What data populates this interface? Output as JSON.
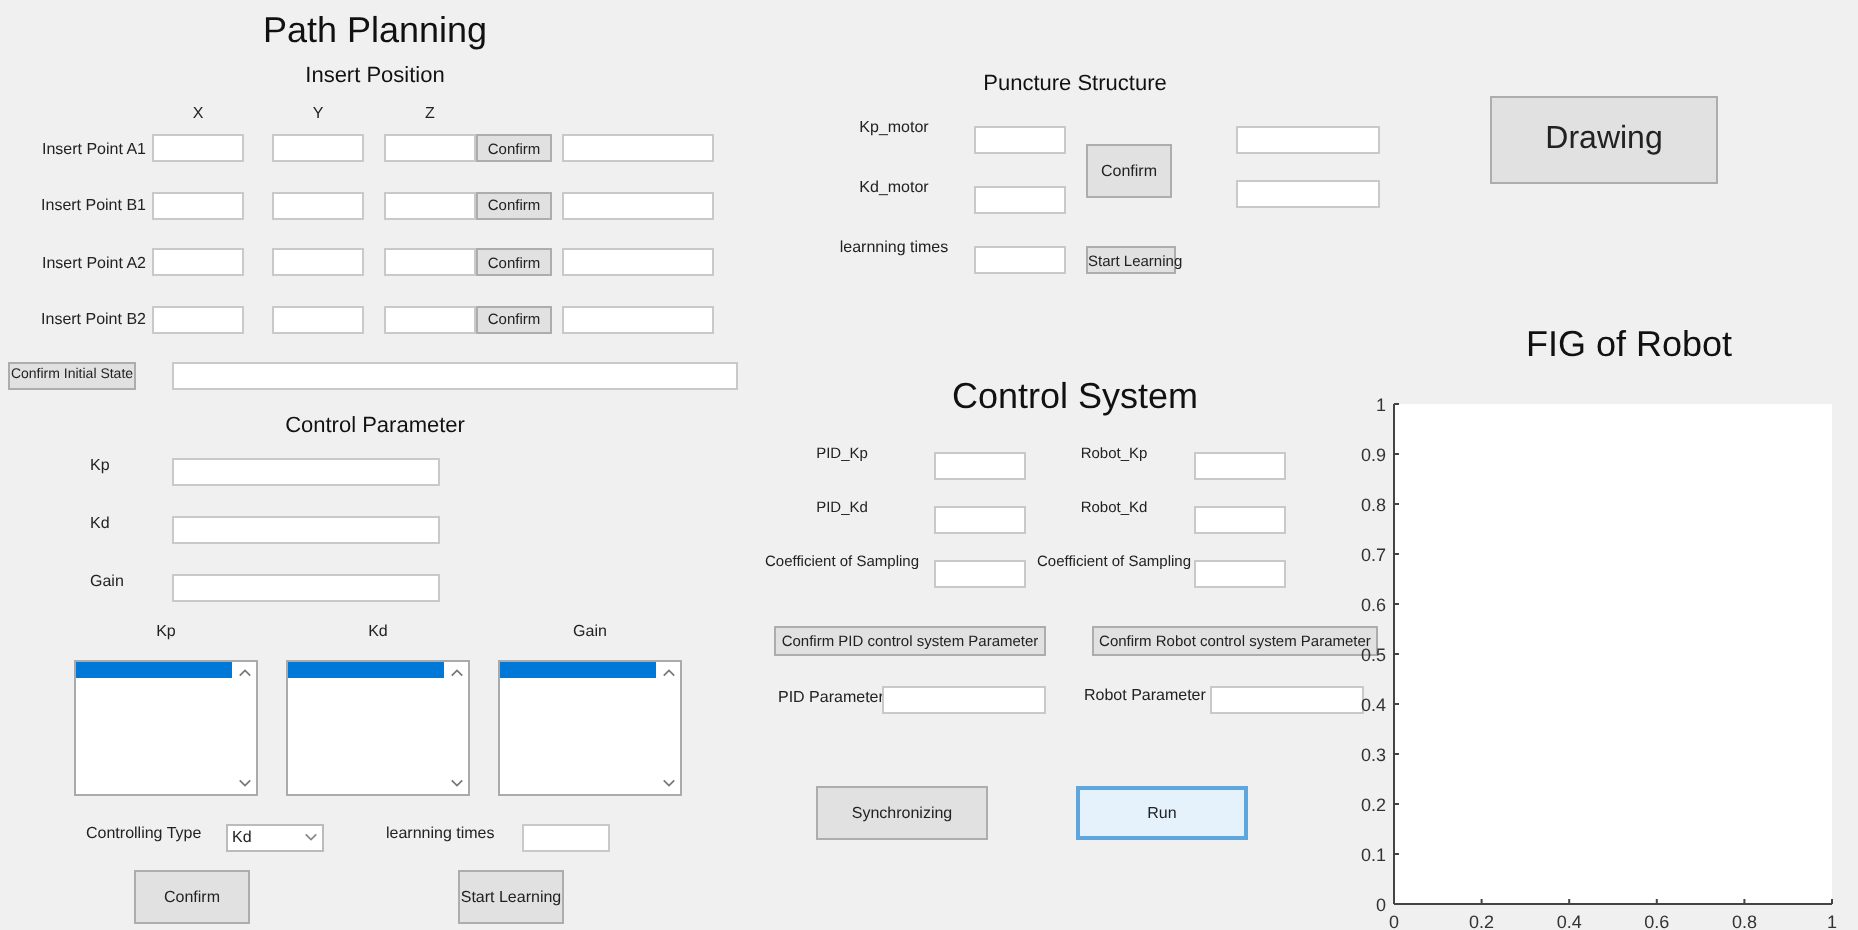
{
  "path_planning": {
    "title": "Path Planning",
    "insert_position": {
      "title": "Insert Position",
      "axes": [
        "X",
        "Y",
        "Z"
      ],
      "rows": [
        {
          "label": "Insert Point A1",
          "button": "Confirm"
        },
        {
          "label": "Insert Point B1",
          "button": "Confirm"
        },
        {
          "label": "Insert Point A2",
          "button": "Confirm"
        },
        {
          "label": "Insert Point B2",
          "button": "Confirm"
        }
      ],
      "initial_state_button": "Confirm Initial State"
    },
    "control_parameter": {
      "title": "Control Parameter",
      "fields": [
        {
          "label": "Kp"
        },
        {
          "label": "Kd"
        },
        {
          "label": "Gain"
        }
      ],
      "lists": [
        {
          "label": "Kp",
          "first_row_selected": true
        },
        {
          "label": "Kd",
          "first_row_selected": true
        },
        {
          "label": "Gain",
          "first_row_selected": true
        }
      ],
      "controlling_type": {
        "label": "Controlling Type",
        "value": "Kd"
      },
      "learning_times": {
        "label": "learnning times"
      },
      "confirm_button": "Confirm",
      "learn_button": "Start Learning"
    }
  },
  "puncture_structure": {
    "title": "Puncture Structure",
    "fields": [
      {
        "label": "Kp_motor"
      },
      {
        "label": "Kd_motor"
      },
      {
        "label": "learnning times"
      }
    ],
    "confirm_button": "Confirm",
    "learn_button": "Start Learning"
  },
  "control_system": {
    "title": "Control System",
    "pid_fields": [
      {
        "label": "PID_Kp"
      },
      {
        "label": "PID_Kd"
      },
      {
        "label": "Coefficient of Sampling"
      }
    ],
    "robot_fields": [
      {
        "label": "Robot_Kp"
      },
      {
        "label": "Robot_Kd"
      },
      {
        "label": "Coefficient of Sampling"
      }
    ],
    "pid_confirm": "Confirm PID control system Parameter",
    "robot_confirm": "Confirm Robot control system Parameter",
    "pid_parameter": "PID Parameter",
    "robot_parameter": "Robot Parameter",
    "buttons": [
      {
        "label": "Synchronizing",
        "focused": false
      },
      {
        "label": "Run",
        "focused": true
      }
    ]
  },
  "drawing_button": "Drawing",
  "figure": {
    "chart_data": {
      "type": "line",
      "title": "FIG of Robot",
      "xlim": [
        0,
        1
      ],
      "ylim": [
        0,
        1
      ],
      "xticks": [
        {
          "value": 0,
          "label": "0"
        },
        {
          "value": 0.2,
          "label": "0.2"
        },
        {
          "value": 0.4,
          "label": "0.4"
        },
        {
          "value": 0.6,
          "label": "0.6"
        },
        {
          "value": 0.8,
          "label": "0.8"
        },
        {
          "value": 1,
          "label": "1"
        }
      ],
      "yticks": [
        {
          "value": 0,
          "label": "0"
        },
        {
          "value": 0.1,
          "label": "0.1"
        },
        {
          "value": 0.2,
          "label": "0.2"
        },
        {
          "value": 0.3,
          "label": "0.3"
        },
        {
          "value": 0.4,
          "label": "0.4"
        },
        {
          "value": 0.5,
          "label": "0.5"
        },
        {
          "value": 0.6,
          "label": "0.6"
        },
        {
          "value": 0.7,
          "label": "0.7"
        },
        {
          "value": 0.8,
          "label": "0.8"
        },
        {
          "value": 0.9,
          "label": "0.9"
        },
        {
          "value": 1,
          "label": "1"
        }
      ]
    }
  }
}
